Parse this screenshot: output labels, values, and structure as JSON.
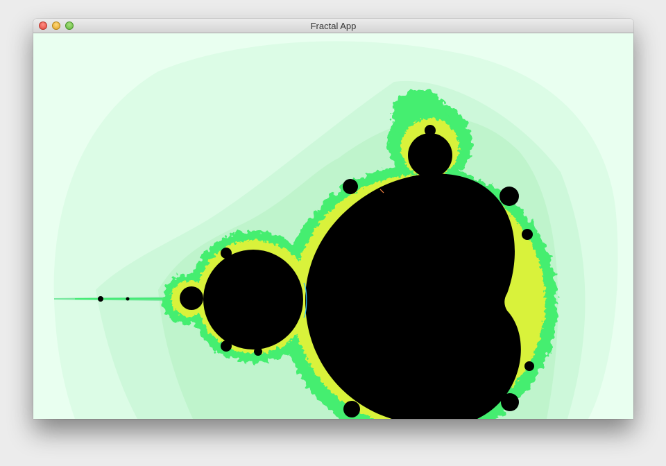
{
  "window": {
    "title": "Fractal App"
  },
  "view": {
    "content": "mandelbrot-set",
    "colors": {
      "set": "#000000",
      "background": "#e9fff0",
      "outer_band": "#d4fae1",
      "inner_band": "#bff5cf",
      "edge_green": "#33ee66",
      "edge_yellow": "#e8f53a"
    }
  }
}
